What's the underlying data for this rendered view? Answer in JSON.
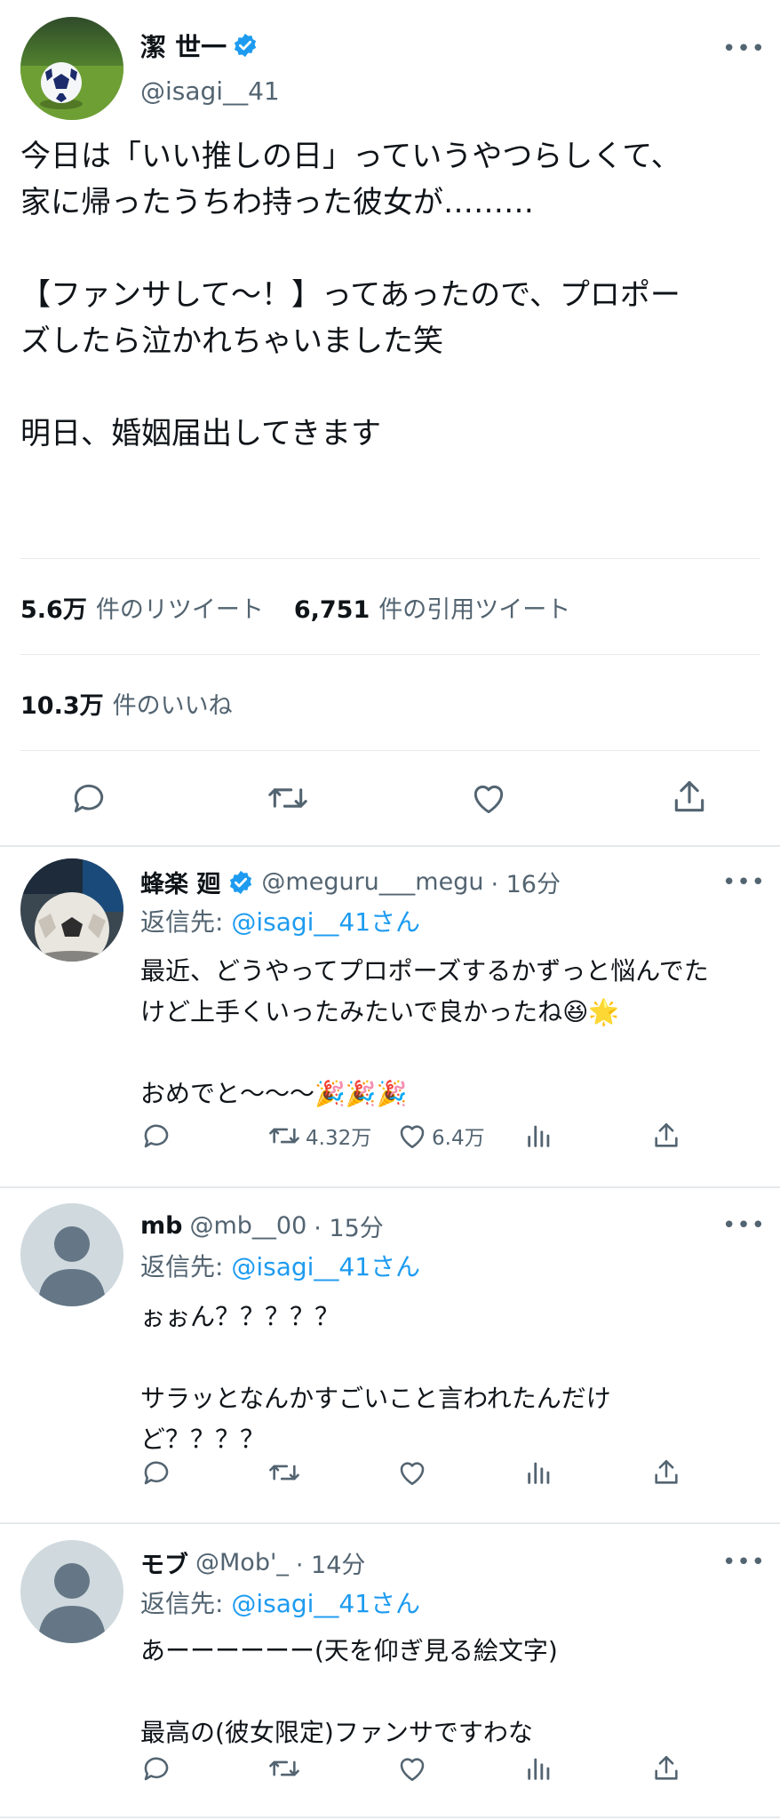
{
  "main_tweet": {
    "display_name": "潔 世一",
    "handle": "@isagi__41",
    "more_label": "•••",
    "text": "今日は「いい推しの日」っていうやつらしくて、\n家に帰ったうちわ持った彼女が………\n\n【ファンサして〜！】ってあったので、プロポー\nズしたら泣かれちゃいました笑\n\n明日、婚姻届出してきます",
    "retweets_value": "5.6万",
    "retweets_label": "件のリツイート",
    "quotes_value": "6,751",
    "quotes_label": "件の引用ツイート",
    "likes_value": "10.3万",
    "likes_label": "件のいいね"
  },
  "replies": [
    {
      "display_name": "蜂楽 廻",
      "handle": "@meguru___megu",
      "time": "· 16分",
      "reply_prefix": "返信先:",
      "reply_to": "@isagi__41さん",
      "text": "最近、どうやってプロポーズするかずっと悩んでた\nけど上手くいったみたいで良かったね😆🌟\n\nおめでと〜〜〜🎉🎉🎉",
      "retweets": "4.32万",
      "likes": "6.4万"
    },
    {
      "display_name": "mb",
      "handle": "@mb__00",
      "time": "· 15分",
      "reply_prefix": "返信先:",
      "reply_to": "@isagi__41さん",
      "text": "ぉぉん？？？？？\n\nサラッとなんかすごいこと言われたんだけ\nど？？？？"
    },
    {
      "display_name": "モブ",
      "handle": "@Mob'_",
      "time": "· 14分",
      "reply_prefix": "返信先:",
      "reply_to": "@isagi__41さん",
      "text": "あーーーーーー(天を仰ぎ見る絵文字)\n\n最高の(彼女限定)ファンサですわな"
    }
  ],
  "icons": [
    "reply-icon",
    "retweet-icon",
    "like-icon",
    "share-icon",
    "analytics-icon",
    "verified-badge-icon",
    "more-icon"
  ],
  "colors": {
    "accent": "#1d9bf0",
    "secondary_text": "#536471",
    "divider": "#e6e9eb"
  }
}
